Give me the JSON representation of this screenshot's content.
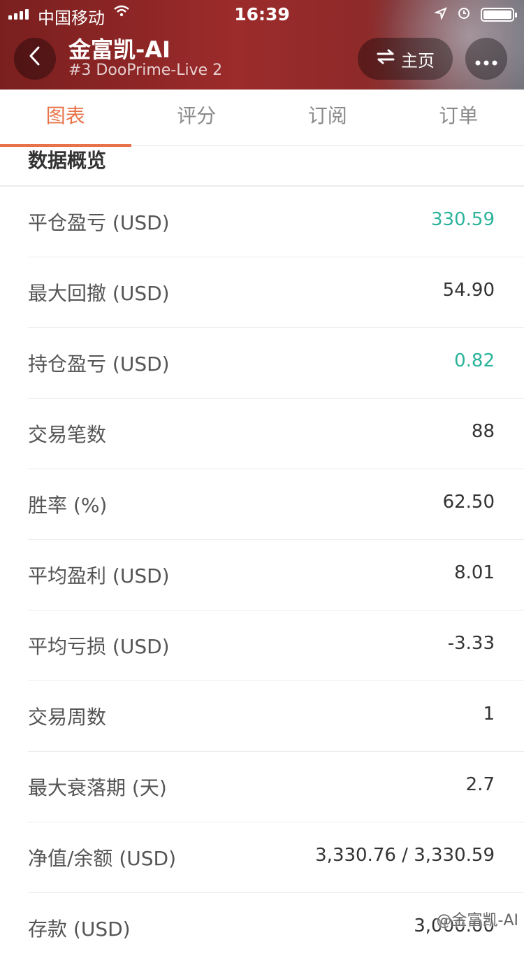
{
  "status_bar": {
    "carrier": "中国移动",
    "time": "16:39"
  },
  "header": {
    "title": "金富凯-AI",
    "subtitle": "#3 DooPrime-Live 2",
    "home_label": "主页"
  },
  "tabs": [
    {
      "label": "图表",
      "active": true
    },
    {
      "label": "评分",
      "active": false
    },
    {
      "label": "订阅",
      "active": false
    },
    {
      "label": "订单",
      "active": false
    }
  ],
  "section": {
    "title": "数据概览"
  },
  "stats": [
    {
      "label": "平仓盈亏 (USD)",
      "value": "330.59",
      "color": "#2bb39a"
    },
    {
      "label": "最大回撤 (USD)",
      "value": "54.90"
    },
    {
      "label": "持仓盈亏 (USD)",
      "value": "0.82",
      "color": "#2bb39a"
    },
    {
      "label": "交易笔数",
      "value": "88"
    },
    {
      "label": "胜率 (%)",
      "value": "62.50"
    },
    {
      "label": "平均盈利 (USD)",
      "value": "8.01"
    },
    {
      "label": "平均亏损 (USD)",
      "value": "-3.33"
    },
    {
      "label": "交易周数",
      "value": "1"
    },
    {
      "label": "最大衰落期 (天)",
      "value": "2.7"
    },
    {
      "label": "净值/余额 (USD)",
      "value": "3,330.76 / 3,330.59"
    },
    {
      "label": "存款 (USD)",
      "value": "3,000.00"
    }
  ],
  "watermark": "@金富凯-AI",
  "colors": {
    "accent": "#e8734a",
    "positive": "#2bb39a"
  }
}
